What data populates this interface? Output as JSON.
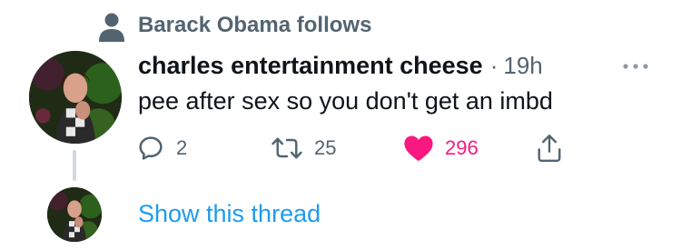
{
  "social_context": {
    "icon": "person-icon",
    "text": "Barack Obama follows"
  },
  "tweet": {
    "author_name": "charles entertainment cheese",
    "separator": "·",
    "timestamp": "19h",
    "text": "pee after sex so you don't get an imbd",
    "actions": {
      "reply_count": "2",
      "retweet_count": "25",
      "like_count": "296",
      "liked": true
    }
  },
  "thread": {
    "show_label": "Show this thread"
  },
  "colors": {
    "text_primary": "#0f1419",
    "text_secondary": "#536471",
    "link_blue": "#1d9bf0",
    "like_pink": "#f91880",
    "thread_line": "#cfd9de"
  },
  "icons": [
    "person-icon",
    "more-icon",
    "reply-icon",
    "retweet-icon",
    "heart-icon",
    "share-icon"
  ]
}
